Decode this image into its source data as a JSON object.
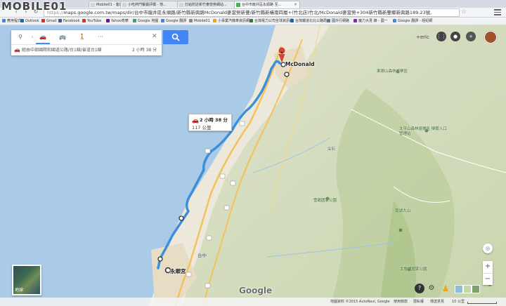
{
  "watermark": {
    "text": "MOBILE01"
  },
  "tabs": [
    {
      "label": "Mobile01 - 客運站..."
    },
    {
      "label": "小吃熱門餐廳評價 - 地..."
    },
    {
      "label": "打給附近新竹麥當勞網站..."
    },
    {
      "label": "台中市龍井區永順路 至..."
    }
  ],
  "address": {
    "host": "https://",
    "path": "maps.google.com.tw/maps/dir/台中市龍井區永順路/新竹縣新興路McDonald麥當勞新豐/新竹縣新橫南四層+(竹北店)竹北/McDonald麥當勞+304新竹縣新豐鄉新興路189.23號,"
  },
  "bookmarks": [
    {
      "label": "應用程式",
      "color": "#4285f4"
    },
    {
      "label": "Outlook",
      "color": "#0072c6"
    },
    {
      "label": "Gmail",
      "color": "#d93025"
    },
    {
      "label": "Facebook",
      "color": "#3b5998"
    },
    {
      "label": "YouTube",
      "color": "#e52d27"
    },
    {
      "label": "Yahoo奇摩",
      "color": "#720e9e"
    },
    {
      "label": "Google 地圖",
      "color": "#34a853"
    },
    {
      "label": "Google 翻譯",
      "color": "#4285f4"
    },
    {
      "label": "Mobile01",
      "color": "#888888"
    },
    {
      "label": "小事業汽機車資訊網",
      "color": "#f0a500"
    },
    {
      "label": "台灣電力公司全球資訊網",
      "color": "#2e7d32"
    },
    {
      "label": "台灣鐵道北北公路局",
      "color": "#1565c0"
    },
    {
      "label": "國外行網路",
      "color": "#607d8b"
    },
    {
      "label": "魔力大見 錄 - 國一",
      "color": "#8e24aa"
    },
    {
      "label": "Google 翻譯 - 經紀網",
      "color": "#4285f4"
    }
  ],
  "directions": {
    "modes": [
      {
        "name": "best",
        "icon": "signpost-icon"
      },
      {
        "name": "drive",
        "icon": "car-icon"
      },
      {
        "name": "transit",
        "icon": "bus-icon"
      },
      {
        "name": "walk",
        "icon": "walk-icon"
      },
      {
        "name": "more",
        "icon": "more-icon"
      }
    ],
    "route_via": "經由中部國際和國道公路/台1線/省道台1線",
    "route_duration": "2 小時 38 分"
  },
  "user": {
    "name": "+eric"
  },
  "bubble": {
    "duration": "2 小時 38 分",
    "distance": "117 公里"
  },
  "places": {
    "origin": "永順宮",
    "destination": "McDonald",
    "labels": [
      "東眼山森林遊樂區",
      "太平山森林遊樂區 棲蘭入口管理站",
      "雪霸國家公園",
      "太魯閣國家公園",
      "南湖大山",
      "尖石",
      "台中"
    ]
  },
  "map_controls": {
    "earth_label": "地球",
    "google_logo": "Google"
  },
  "footer": {
    "copyright": "地圖資料 ©2015 AutoNavi, Google",
    "terms": "使用條款",
    "privacy": "隱私權",
    "report": "傳送意見",
    "scale": "10 公里"
  }
}
